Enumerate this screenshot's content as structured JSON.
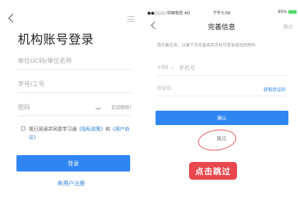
{
  "left": {
    "title": "机构账号登录",
    "fields": {
      "org_placeholder": "单位UC码/单位名称",
      "id_placeholder": "学号/工号",
      "password_placeholder": "密码",
      "forgot": "忘记密码?"
    },
    "agreement": {
      "prefix": "我已阅读并同意学习通",
      "privacy": "《隐私政策》",
      "and": "和",
      "terms": "《用户协议》"
    },
    "login_button": "登录",
    "register_link": "新用户注册"
  },
  "right": {
    "status": {
      "carrier": "●●○○○ 中国电信 4G",
      "time": "下午3:09",
      "battery": "95%"
    },
    "nav": {
      "title": "完善信息",
      "skip": "跳过"
    },
    "hint": "请完善信息，以便下次可直接用手机号登录或找回密码",
    "phone": {
      "prefix": "+86 ⌄",
      "placeholder": "手机号"
    },
    "code": {
      "placeholder": "验证码",
      "get_code": "获取验证码"
    },
    "confirm_button": "确认",
    "skip_link": "跳过",
    "annotation": "点击跳过",
    "colors": {
      "accent": "#2f86f2",
      "annotation": "#e8474d"
    }
  }
}
